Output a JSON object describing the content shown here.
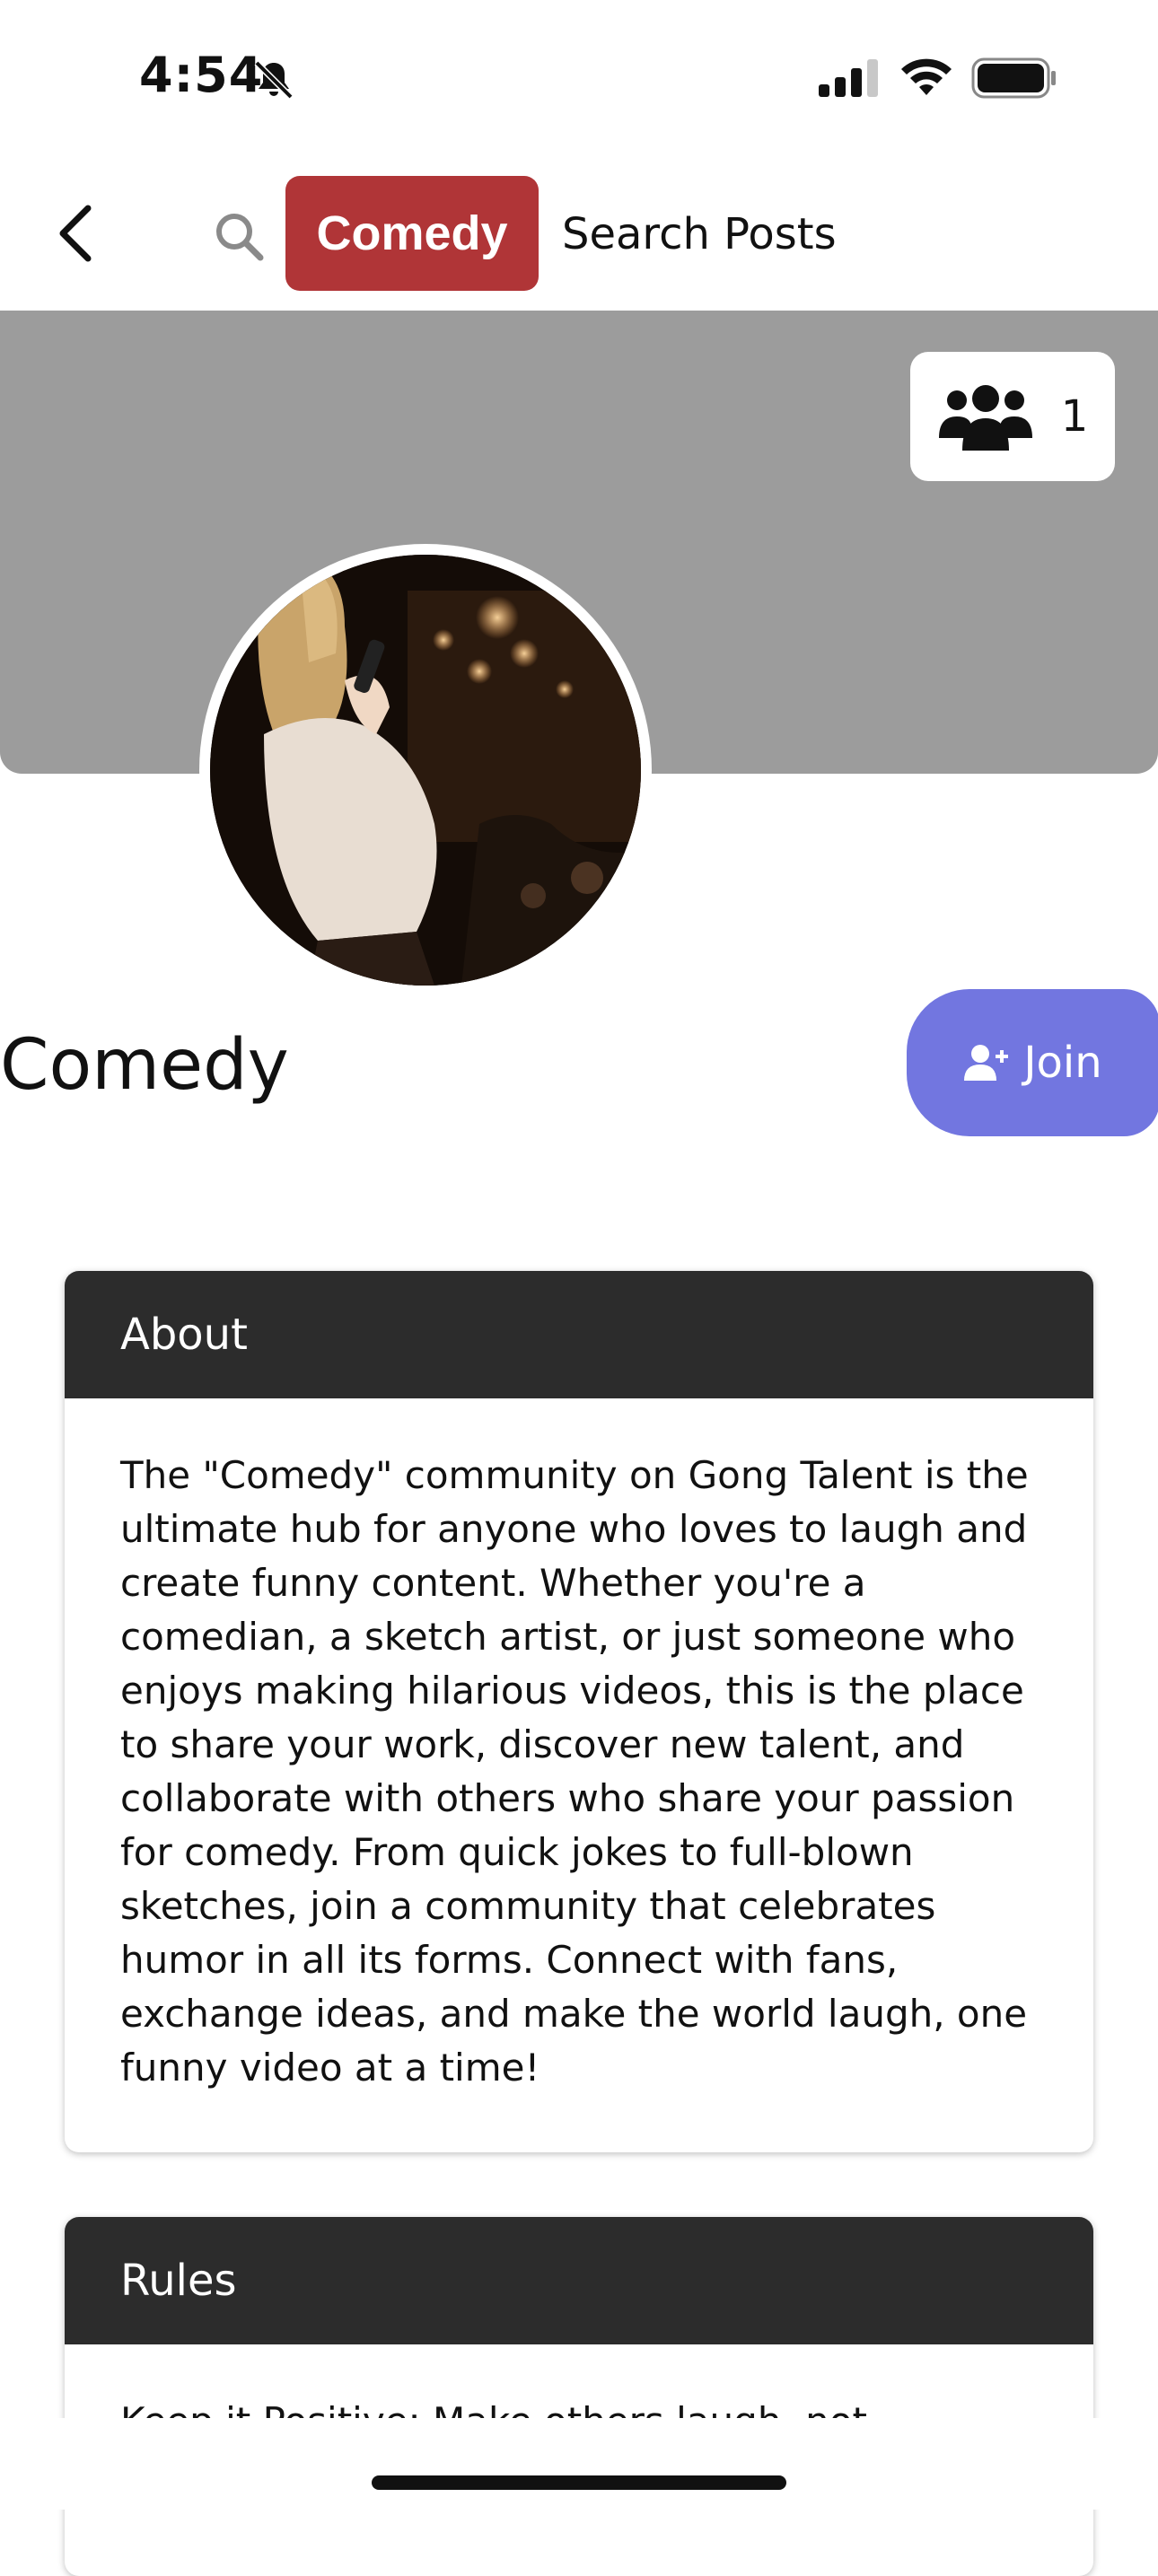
{
  "status_bar": {
    "time": "4:54",
    "icons": [
      "bell-slash-icon",
      "signal-icon",
      "wifi-icon",
      "battery-icon"
    ]
  },
  "nav": {
    "back_icon": "chevron-left-icon",
    "search_icon": "search-icon",
    "tag_label": "Comedy",
    "search_label": "Search Posts",
    "tag_color": "#b03537"
  },
  "cover": {
    "color": "#9c9c9c",
    "member_icon": "group-icon",
    "member_count": "1"
  },
  "community": {
    "name": "Comedy",
    "join_label": "Join",
    "join_icon": "add-user-icon",
    "join_color": "#7276e0"
  },
  "about": {
    "title": "About",
    "text": "The \"Comedy\" community on Gong Talent is the ultimate hub for anyone who loves to laugh and create funny content. Whether you're a comedian, a sketch artist, or just someone who enjoys making hilarious videos, this is the place to share your work, discover new talent, and collaborate with others who share your passion for comedy. From quick jokes to full-blown sketches, join a community that celebrates humor in all its forms. Connect with fans, exchange ideas, and make the world laugh, one funny video at a time!"
  },
  "rules": {
    "title": "Rules",
    "text": "Keep it Positive: Make others laugh, not"
  }
}
